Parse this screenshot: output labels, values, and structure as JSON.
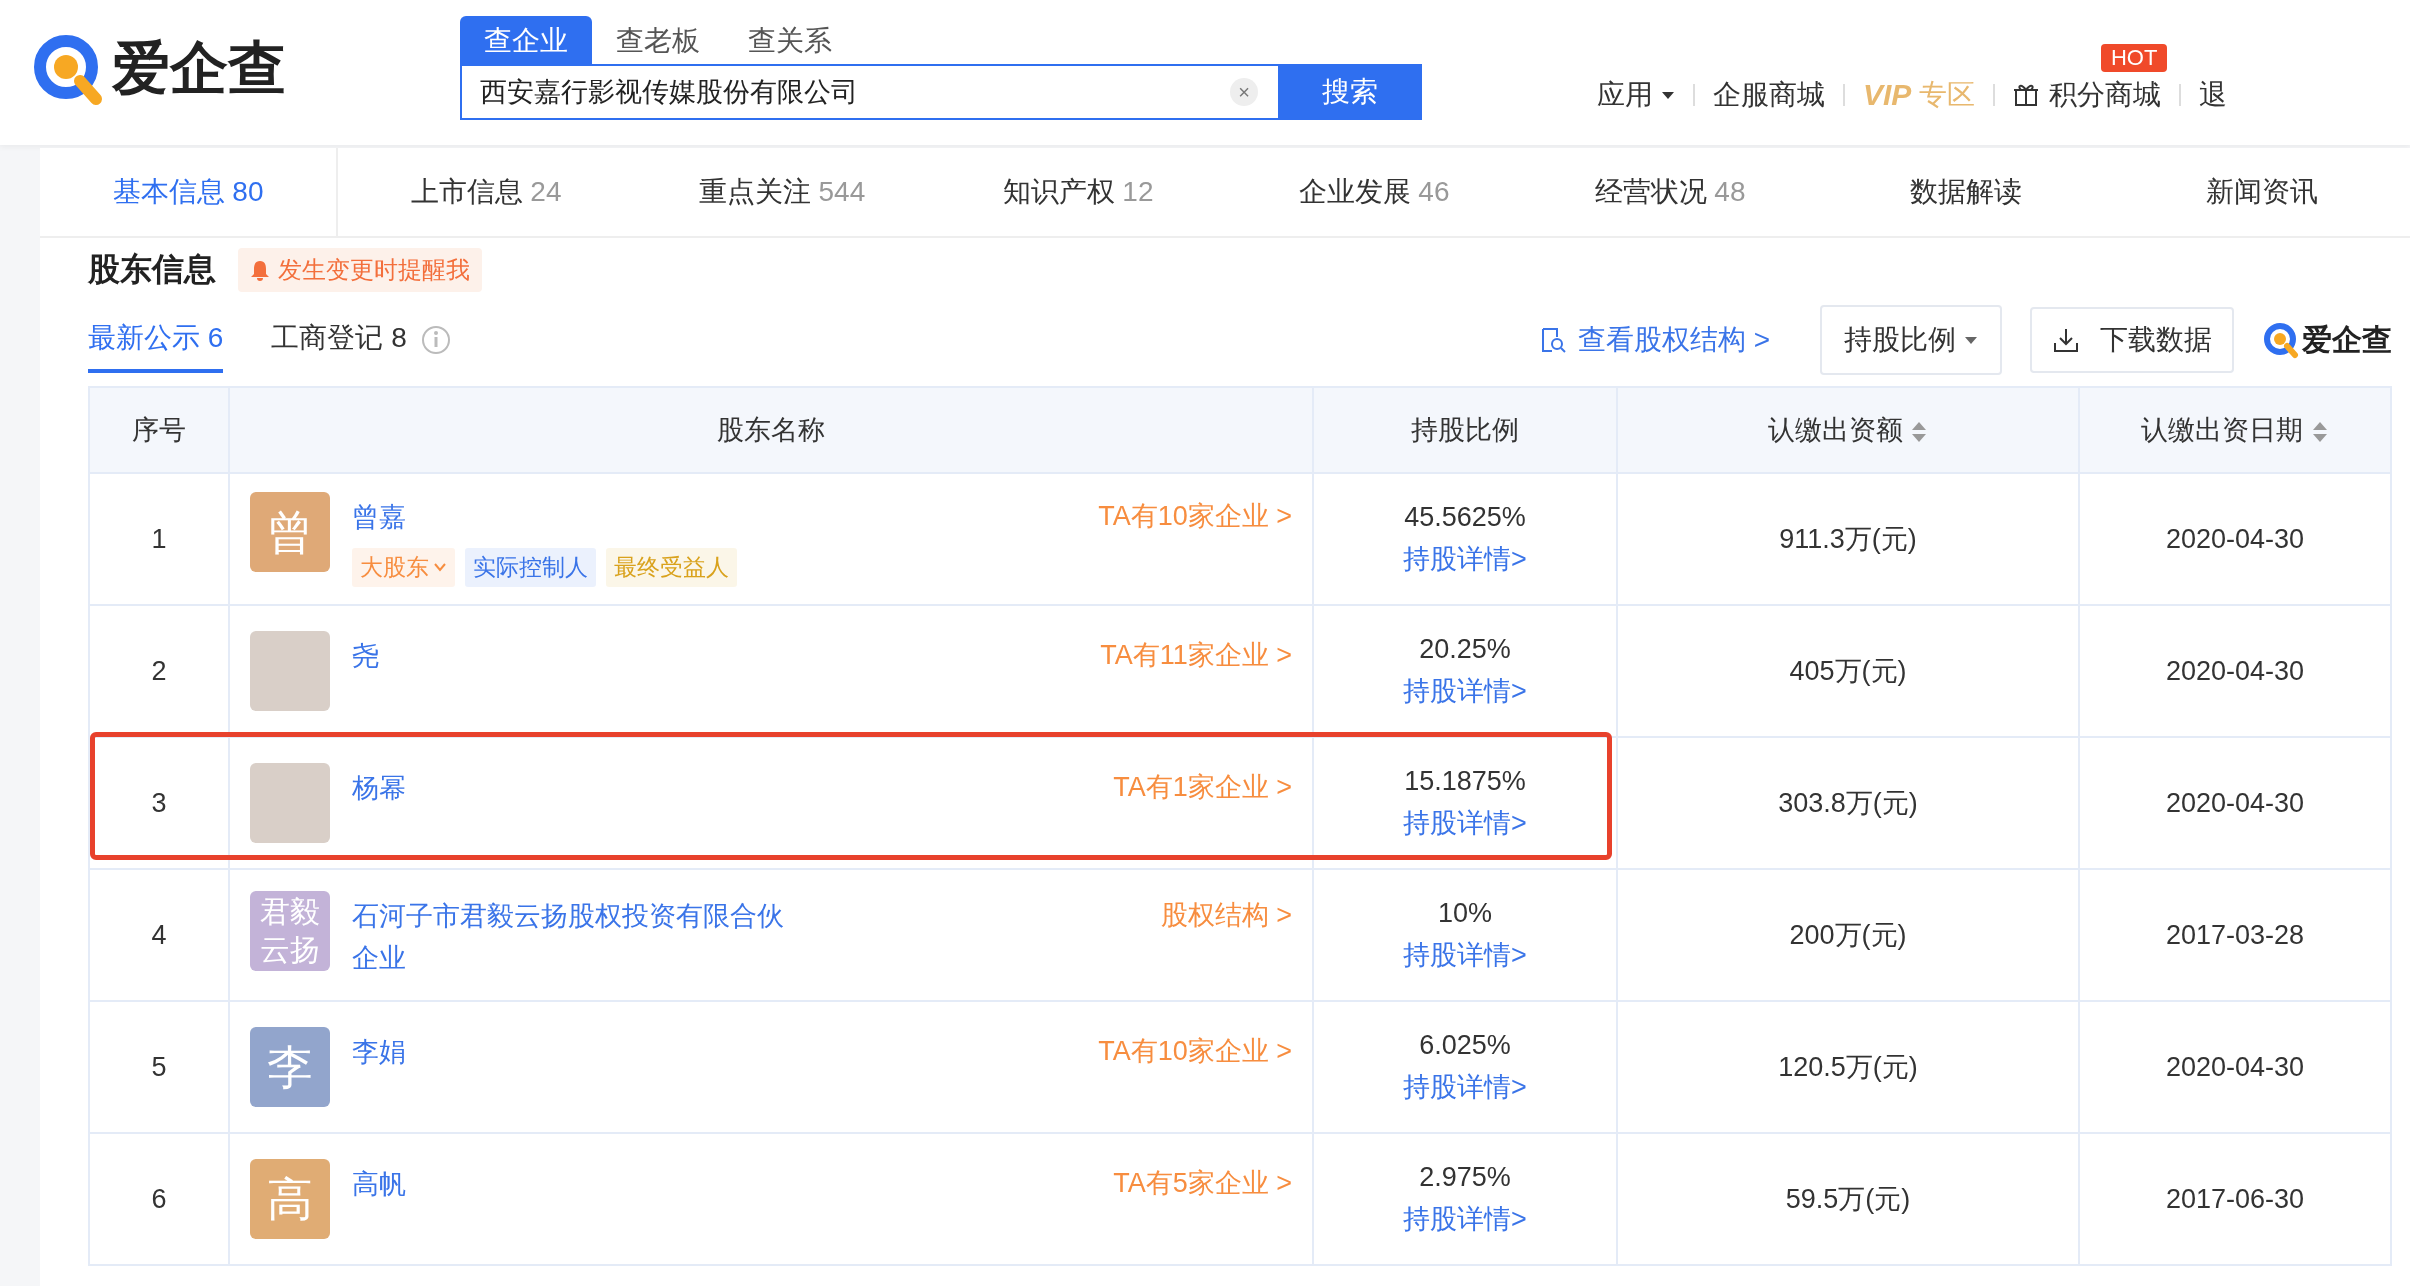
{
  "header": {
    "logo_text": "爱企查",
    "search_tabs": [
      {
        "label": "查企业",
        "selected": true
      },
      {
        "label": "查老板",
        "selected": false
      },
      {
        "label": "查关系",
        "selected": false
      }
    ],
    "search": {
      "value": "西安嘉行影视传媒股份有限公司",
      "clear": "×",
      "button": "搜索"
    },
    "nav": [
      {
        "kind": "dropdown",
        "label": "应用"
      },
      {
        "kind": "link",
        "label": "企服商城"
      },
      {
        "kind": "vip",
        "label": "VIP",
        "suffix": "专区"
      },
      {
        "kind": "gift",
        "label": "积分商城",
        "badge": "HOT"
      },
      {
        "kind": "link",
        "label": "退"
      }
    ]
  },
  "tabs": [
    {
      "label": "基本信息",
      "count": "80",
      "selected": true
    },
    {
      "label": "上市信息",
      "count": "24",
      "selected": false
    },
    {
      "label": "重点关注",
      "count": "544",
      "selected": false
    },
    {
      "label": "知识产权",
      "count": "12",
      "selected": false
    },
    {
      "label": "企业发展",
      "count": "46",
      "selected": false
    },
    {
      "label": "经营状况",
      "count": "48",
      "selected": false
    },
    {
      "label": "数据解读",
      "selected": false
    },
    {
      "label": "新闻资讯",
      "selected": false
    }
  ],
  "section": {
    "title": "股东信息",
    "reminder": "发生变更时提醒我",
    "subtabs": [
      {
        "label": "最新公示 6",
        "selected": true
      },
      {
        "label": "工商登记 8",
        "selected": false
      }
    ],
    "structure_link": "查看股权结构 >",
    "sort_select": "持股比例",
    "download": "下载数据",
    "brand": "爱企查"
  },
  "table": {
    "columns": [
      {
        "label": "序号",
        "sortable": false
      },
      {
        "label": "股东名称",
        "sortable": false
      },
      {
        "label": "持股比例",
        "sortable": false
      },
      {
        "label": "认缴出资额",
        "sortable": true
      },
      {
        "label": "认缴出资日期",
        "sortable": true
      }
    ],
    "rows": [
      {
        "index": "1",
        "avatar": {
          "kind": "text",
          "text": "曾",
          "color": "#dfa977"
        },
        "name": "曾嘉",
        "tags": [
          {
            "label": "大股东",
            "dropdown": true,
            "color": "#f78d3f"
          },
          {
            "label": "实际控制人",
            "dropdown": false,
            "color": "#3a74e8"
          },
          {
            "label": "最终受益人",
            "dropdown": false,
            "color": "#d9a21c"
          }
        ],
        "link": "TA有10家企业 >",
        "share": "45.5625%",
        "detail": "持股详情>",
        "amount": "911.3万(元)",
        "date": "2020-04-30",
        "highlighted": false
      },
      {
        "index": "2",
        "avatar": {
          "kind": "photo"
        },
        "name": "尧",
        "link": "TA有11家企业 >",
        "share": "20.25%",
        "detail": "持股详情>",
        "amount": "405万(元)",
        "date": "2020-04-30",
        "highlighted": false
      },
      {
        "index": "3",
        "avatar": {
          "kind": "photo"
        },
        "name": "杨幂",
        "link": "TA有1家企业 >",
        "share": "15.1875%",
        "detail": "持股详情>",
        "amount": "303.8万(元)",
        "date": "2020-04-30",
        "highlighted": true
      },
      {
        "index": "4",
        "avatar": {
          "kind": "text",
          "text": "君毅云扬",
          "color": "#c3b3d8"
        },
        "name": "石河子市君毅云扬股权投资有限合伙企业",
        "link": "股权结构 >",
        "share": "10%",
        "detail": "持股详情>",
        "amount": "200万(元)",
        "date": "2017-03-28",
        "highlighted": false
      },
      {
        "index": "5",
        "avatar": {
          "kind": "text",
          "text": "李",
          "color": "#92a5cc"
        },
        "name": "李娟",
        "link": "TA有10家企业 >",
        "share": "6.025%",
        "detail": "持股详情>",
        "amount": "120.5万(元)",
        "date": "2020-04-30",
        "highlighted": false
      },
      {
        "index": "6",
        "avatar": {
          "kind": "text",
          "text": "高",
          "color": "#e0ac74"
        },
        "name": "高帆",
        "link": "TA有5家企业 >",
        "share": "2.975%",
        "detail": "持股详情>",
        "amount": "59.5万(元)",
        "date": "2017-06-30",
        "highlighted": false
      }
    ]
  }
}
